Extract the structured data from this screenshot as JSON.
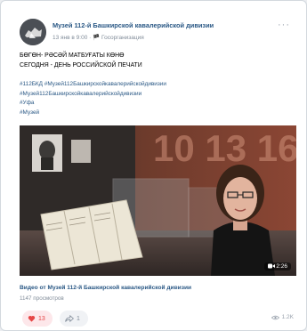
{
  "post": {
    "group_name": "Музей 112-й Башкирской кавалерийской дивизии",
    "meta": "13 янв в 9:00 · 🏴 Госорганизация",
    "more_icon": "···",
    "text_line1": "БӨГӨН- РӘСӘЙ МАТБУҒАТЫ КӨНӨ",
    "text_line2": "СЕГОДНЯ - ДЕНЬ РОССИЙСКОЙ ПЕЧАТИ",
    "hashtags": [
      "#112БКД #Музей112Башкирскойкавалерийскойдивизии",
      "#Музей112Башкирскойкавалерийскойдивизии",
      "#Уфа",
      "#Музей"
    ]
  },
  "video": {
    "duration": "2:26",
    "title": "Видео от Музей 112-й Башкирской кавалерийской дивизии",
    "views": "1147 просмотров",
    "wall_numbers": "10 13 16"
  },
  "footer": {
    "likes": "13",
    "shares": "1",
    "views_count": "1.2K"
  },
  "colors": {
    "link": "#2a5885",
    "like": "#e64646",
    "muted": "#818c99"
  },
  "icons": [
    "museum-logo-icon",
    "more-icon",
    "heart-icon",
    "share-icon",
    "eye-icon",
    "video-camera-icon"
  ]
}
